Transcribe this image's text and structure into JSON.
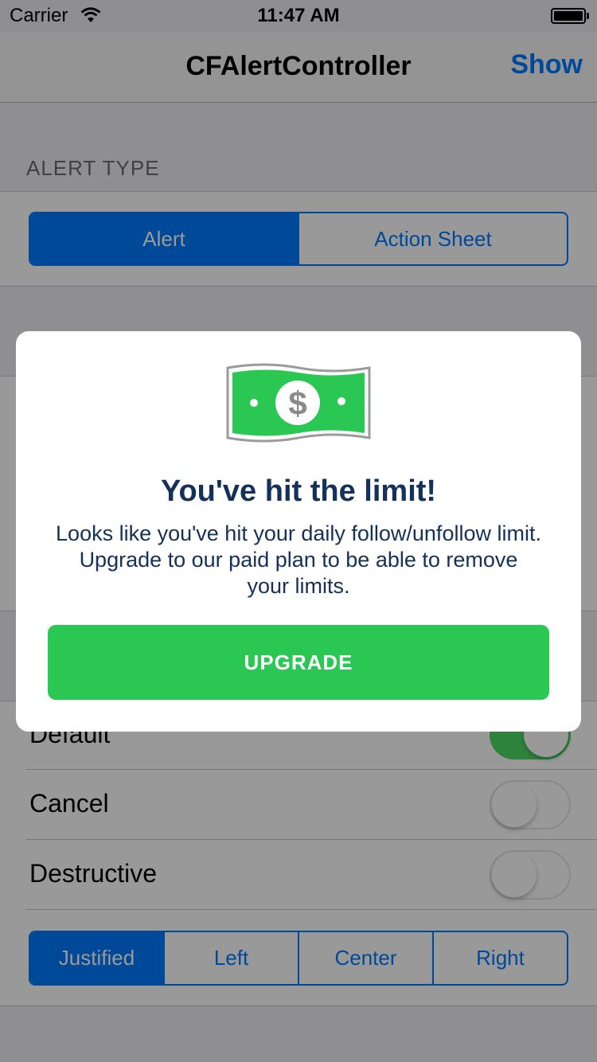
{
  "status_bar": {
    "carrier": "Carrier",
    "time": "11:47 AM"
  },
  "nav": {
    "title": "CFAlertController",
    "show_label": "Show"
  },
  "alert_type": {
    "header": "ALERT TYPE",
    "options": [
      {
        "label": "Alert",
        "selected": true
      },
      {
        "label": "Action Sheet",
        "selected": false
      }
    ]
  },
  "buttons_section": {
    "rows": [
      {
        "label": "Default",
        "on": true
      },
      {
        "label": "Cancel",
        "on": false
      },
      {
        "label": "Destructive",
        "on": false
      }
    ],
    "alignment_options": [
      {
        "label": "Justified",
        "selected": true
      },
      {
        "label": "Left",
        "selected": false
      },
      {
        "label": "Center",
        "selected": false
      },
      {
        "label": "Right",
        "selected": false
      }
    ]
  },
  "dialog": {
    "icon": "dollar-bill-icon",
    "title": "You've hit the limit!",
    "message": "Looks like you've hit your daily follow/unfollow limit. Upgrade to our paid plan to be able to remove your limits.",
    "button_label": "UPGRADE"
  },
  "colors": {
    "accent": "#007aff",
    "upgrade_green": "#2ac852",
    "dialog_text": "#13315a",
    "toggle_on": "#4cd964"
  }
}
